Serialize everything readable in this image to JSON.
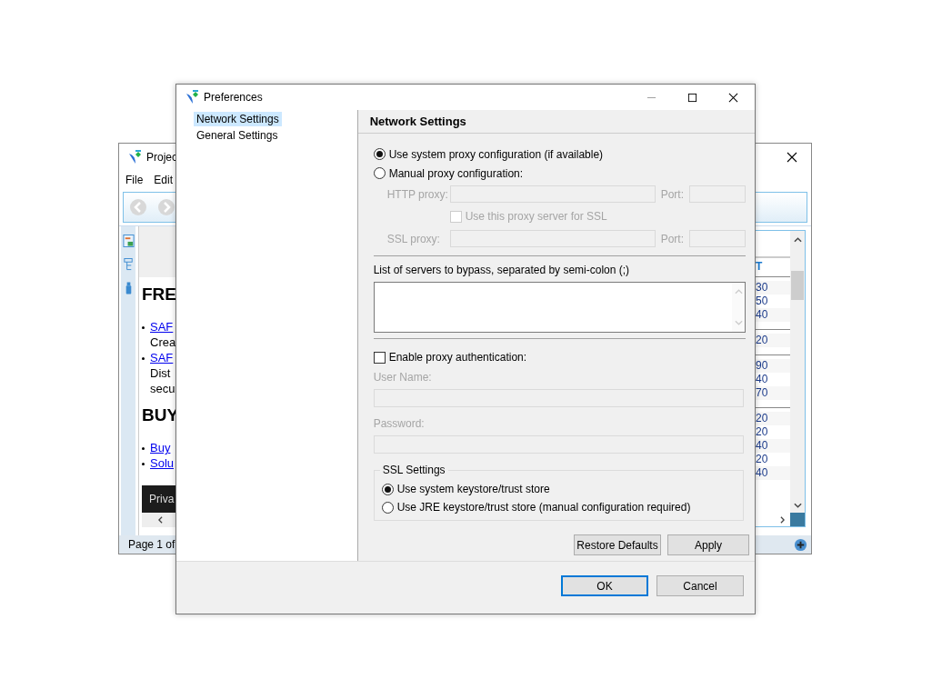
{
  "background_window": {
    "title": "Projec",
    "menu": [
      "File",
      "Edit"
    ],
    "page_blocks": [
      {
        "kind": "heading",
        "text": "FRE"
      },
      {
        "kind": "bullet",
        "link": "SAF",
        "lines": [
          "Crea"
        ]
      },
      {
        "kind": "bullet",
        "link": "SAF",
        "lines": [
          "Dist",
          "secu"
        ]
      },
      {
        "kind": "heading",
        "text": "BUY"
      },
      {
        "kind": "bullet",
        "link": "Buy"
      },
      {
        "kind": "bullet",
        "link": "Solu"
      }
    ],
    "footer_bar": "Priva",
    "table": {
      "header": "T",
      "groups": [
        [
          "30",
          "50",
          "40"
        ],
        [
          "20"
        ],
        [
          "90",
          "40",
          "70"
        ],
        [
          "20",
          "20",
          "40",
          "20",
          "40"
        ]
      ]
    },
    "status": "Page 1 of"
  },
  "dialog": {
    "title": "Preferences",
    "nav": [
      {
        "label": "Network Settings",
        "selected": true
      },
      {
        "label": "General Settings",
        "selected": false
      }
    ],
    "section_title": "Network Settings",
    "proxy_modes": [
      {
        "label": "Use system proxy configuration (if available)",
        "selected": true
      },
      {
        "label": "Manual proxy configuration:",
        "selected": false
      }
    ],
    "http": {
      "label": "HTTP proxy:",
      "port_label": "Port:"
    },
    "use_for_ssl": {
      "label": "Use this proxy server for SSL",
      "checked": false
    },
    "ssl": {
      "label": "SSL proxy:",
      "port_label": "Port:"
    },
    "bypass_label": "List of servers to bypass, separated by semi-colon (;)",
    "auth": {
      "label": "Enable proxy authentication:",
      "checked": false
    },
    "user_name_label": "User Name:",
    "password_label": "Password:",
    "ssl_settings": {
      "title": "SSL Settings",
      "options": [
        {
          "label": "Use system keystore/trust store",
          "selected": true
        },
        {
          "label": "Use JRE keystore/trust store (manual configuration required)",
          "selected": false
        }
      ]
    },
    "buttons": {
      "restore": "Restore Defaults",
      "apply": "Apply",
      "ok": "OK",
      "cancel": "Cancel"
    }
  }
}
